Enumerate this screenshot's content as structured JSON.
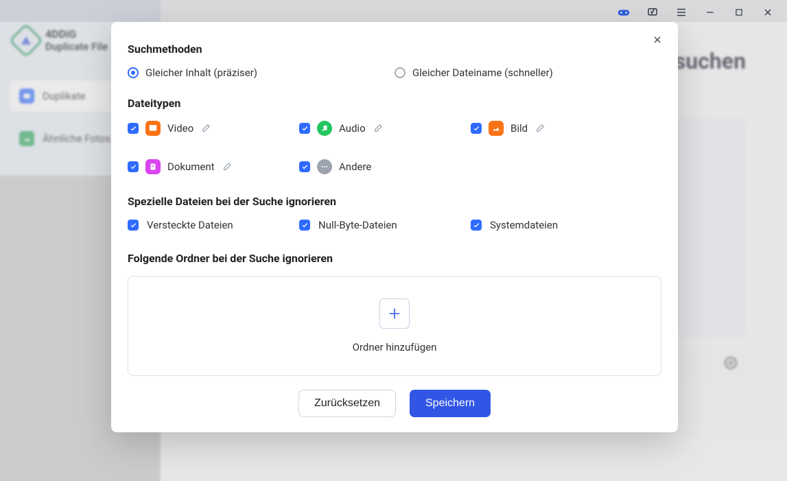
{
  "brand": {
    "title": "4DDiG",
    "sub": "Duplicate File"
  },
  "sidebar": {
    "items": [
      {
        "label": "Duplikate"
      },
      {
        "label": "Ähnliche Fotos"
      }
    ]
  },
  "page": {
    "title_fragment": "suchen"
  },
  "modal": {
    "section_search_methods": "Suchmethoden",
    "radio_content": "Gleicher Inhalt (präziser)",
    "radio_filename": "Gleicher Dateiname (schneller)",
    "selected_radio": "content",
    "section_file_types": "Dateitypen",
    "filetypes": {
      "video": "Video",
      "audio": "Audio",
      "image": "Bild",
      "document": "Dokument",
      "other": "Andere"
    },
    "section_ignore_special": "Spezielle Dateien bei der Suche ignorieren",
    "ignore": {
      "hidden": "Versteckte Dateien",
      "zero": "Null-Byte-Dateien",
      "system": "Systemdateien"
    },
    "section_ignore_folders": "Folgende Ordner bei der Suche ignorieren",
    "add_folder_label": "Ordner hinzufügen",
    "btn_reset": "Zurücksetzen",
    "btn_save": "Speichern"
  }
}
